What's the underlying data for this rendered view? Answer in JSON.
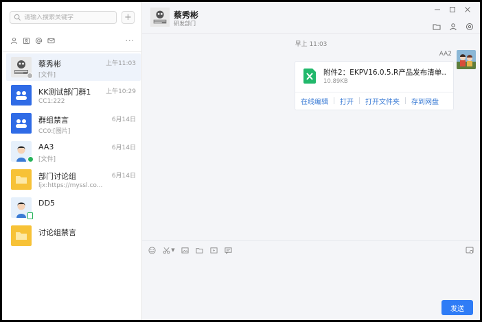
{
  "search": {
    "placeholder": "请输入搜索关键字"
  },
  "sidebar": {
    "add_label": "+",
    "filter_icons": [
      "user-icon",
      "group-icon",
      "at-icon",
      "mail-icon"
    ],
    "more_label": "···"
  },
  "conversations": [
    {
      "name": "蔡秀彬",
      "preview": "[文件]",
      "time": "上午11:03",
      "avatar": "photo-avatar",
      "active": true
    },
    {
      "name": "KK测试部门群1",
      "preview": "CC1:222",
      "time": "上午10:29",
      "avatar": "group-avatar"
    },
    {
      "name": "群组禁言",
      "preview": "CC0:[图片]",
      "time": "6月14日",
      "avatar": "group-avatar"
    },
    {
      "name": "AA3",
      "preview": "[文件]",
      "time": "6月14日",
      "avatar": "person-avatar",
      "status": "online"
    },
    {
      "name": "部门讨论组",
      "preview": "ljx:https://myssl.co...",
      "time": "6月14日",
      "avatar": "folder-avatar"
    },
    {
      "name": "DD5",
      "preview": "",
      "time": "",
      "avatar": "person-avatar",
      "status": "mobile"
    },
    {
      "name": "讨论组禁言",
      "preview": "",
      "time": "",
      "avatar": "folder-avatar"
    }
  ],
  "chat": {
    "title": "蔡秀彬",
    "subtitle": "研发部门",
    "timestamp": "早上 11:03",
    "sender": "AA2",
    "file": {
      "name": "附件2：EKPV16.0.5.R产品发布清单...",
      "size": "10.89KB",
      "actions": [
        "在线编辑",
        "打开",
        "打开文件夹",
        "存到网盘"
      ]
    },
    "send_label": "发送"
  },
  "colors": {
    "accent": "#2f7cf6",
    "group": "#2f6be6",
    "folder": "#f7c237",
    "excel": "#21b86b",
    "online": "#27b35b"
  }
}
